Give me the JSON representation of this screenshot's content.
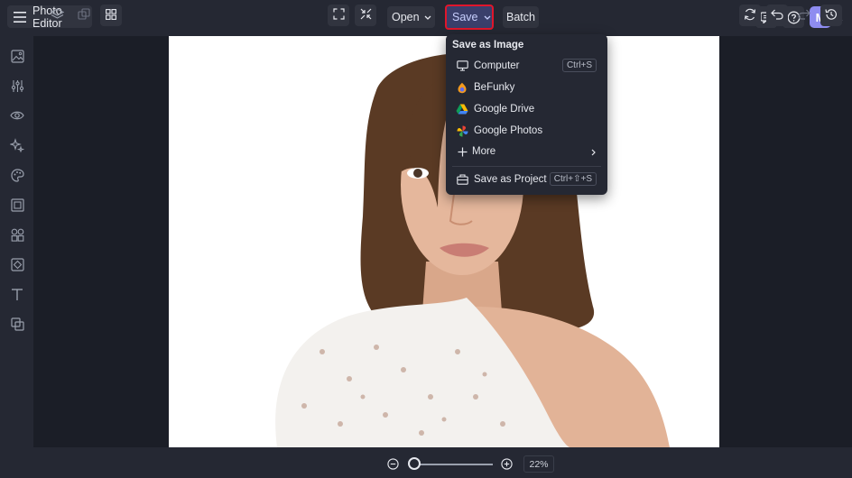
{
  "app": {
    "title": "Photo Editor"
  },
  "toolbar": {
    "open_label": "Open",
    "save_label": "Save",
    "batch_label": "Batch"
  },
  "user": {
    "avatar_initial": "M"
  },
  "save_menu": {
    "title": "Save as Image",
    "items": [
      {
        "label": "Computer",
        "shortcut": "Ctrl+S",
        "icon": "monitor-icon"
      },
      {
        "label": "BeFunky",
        "shortcut": "",
        "icon": "befunky-logo-icon"
      },
      {
        "label": "Google Drive",
        "shortcut": "",
        "icon": "google-drive-icon"
      },
      {
        "label": "Google Photos",
        "shortcut": "",
        "icon": "google-photos-icon"
      },
      {
        "label": "More",
        "shortcut": "",
        "icon": "plus-icon"
      },
      {
        "label": "Save as Project",
        "shortcut": "Ctrl+⇧+S",
        "icon": "project-icon"
      }
    ]
  },
  "sidebar": {
    "tools": [
      "image-icon",
      "sliders-icon",
      "eye-icon",
      "sparkle-icon",
      "palette-icon",
      "frame-icon",
      "shapes-icon",
      "graphics-icon",
      "text-icon",
      "layers-overlay-icon"
    ]
  },
  "zoom": {
    "label": "22%",
    "level": 0.0
  },
  "colors": {
    "accent": "#8e8cf0",
    "highlight_border": "#e0162b",
    "save_bg": "#3a3f6b",
    "panel": "#252833",
    "background": "#1b1e27"
  }
}
